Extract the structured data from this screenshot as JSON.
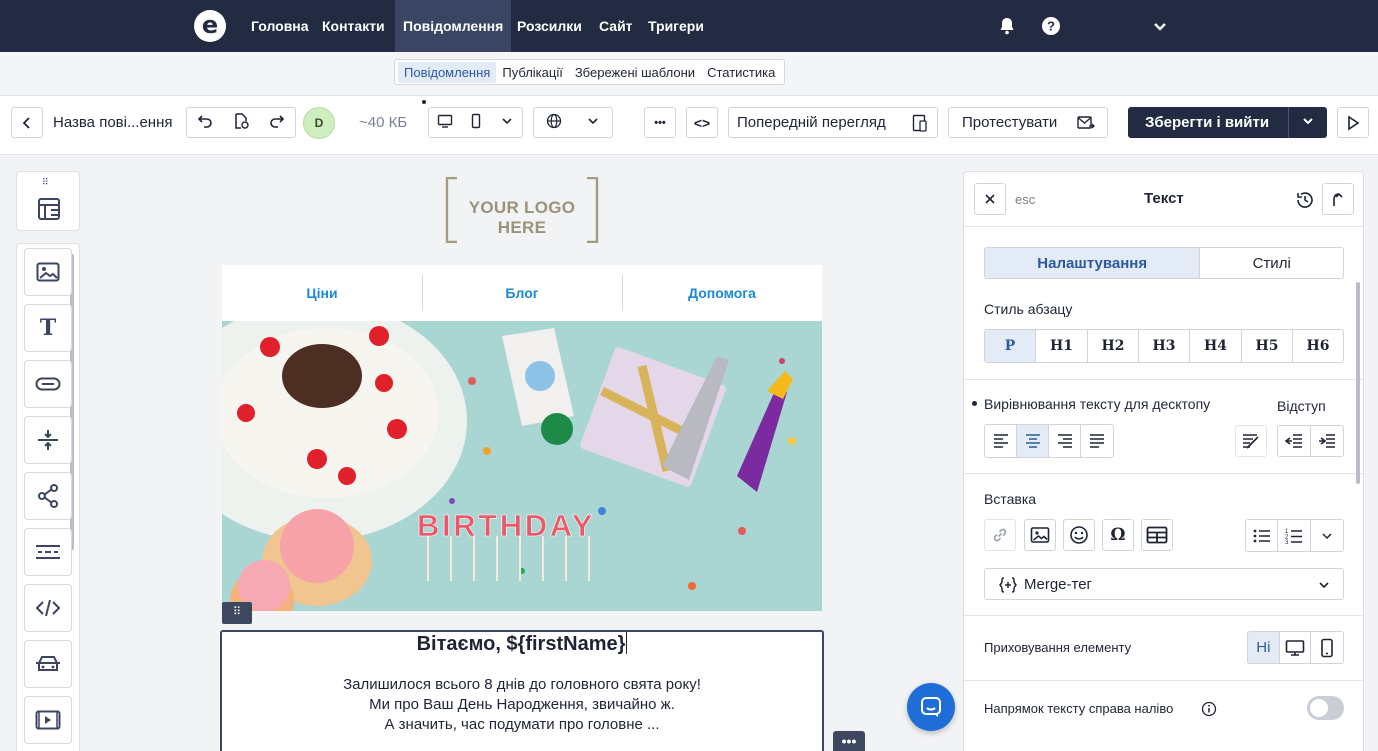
{
  "topnav": {
    "logo": "e",
    "items": [
      "Головна",
      "Контакти",
      "Повідомлення",
      "Розсилки",
      "Сайт",
      "Тригери"
    ],
    "active": "Повідомлення",
    "icons": [
      "bell-icon",
      "help-icon",
      "chevron-down-icon"
    ]
  },
  "subnav": {
    "items": [
      "Повідомлення",
      "Публікації",
      "Збережені шаблони",
      "Статистика"
    ],
    "active": "Повідомлення"
  },
  "toolbar": {
    "message_name": "Назва пові...ення",
    "avatar_initial": "D",
    "size": "~40 КБ",
    "preview_label": "Попередній перегляд",
    "test_label": "Протестувати",
    "save_label": "Зберегти і вийти",
    "more_label": "•••",
    "code_label": "<>"
  },
  "canvas": {
    "logo_text": "YOUR LOGO HERE",
    "menu": [
      "Ціни",
      "Блог",
      "Допомога"
    ],
    "hero_text": "BIRTHDAY",
    "greeting": "Вітаємо, ${firstName}",
    "body_lines": [
      "Залишилося всього 8 днів до головного свята року!",
      "Ми про Ваш День Народження, звичайно ж.",
      "А значить, час подумати про головне ..."
    ]
  },
  "panel": {
    "close_hint": "esc",
    "title": "Текст",
    "tabs": [
      "Налаштування",
      "Стилі"
    ],
    "active_tab": "Налаштування",
    "paragraph_label": "Стиль абзацу",
    "paragraph_styles": [
      "P",
      "H1",
      "H2",
      "H3",
      "H4",
      "H5",
      "H6"
    ],
    "align_label": "Вирівнювання тексту для десктопу",
    "indent_label": "Відступ",
    "insert_label": "Вставка",
    "merge_label": "Merge-тег",
    "hide_label": "Приховування елементу",
    "hide_options": [
      "Ні"
    ],
    "rtl_label": "Напрямок тексту справа наліво"
  }
}
